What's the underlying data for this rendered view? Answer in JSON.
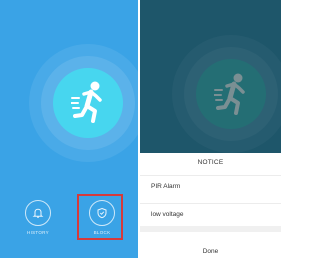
{
  "left_screen": {
    "center_icon": "running-man-icon",
    "history_label": "HISTORY",
    "history_icon": "bell-icon",
    "block_label": "BLOCK",
    "block_icon": "shield-icon",
    "highlight_color": "#d63a3a",
    "background_color": "#3aa3e6",
    "core_color": "#47d6ef"
  },
  "right_screen": {
    "center_icon": "running-man-icon",
    "background_color": "#1e566a",
    "notice": {
      "title": "NOTICE",
      "items": [
        "PIR Alarm",
        "low voltage"
      ],
      "done_label": "Done"
    }
  }
}
